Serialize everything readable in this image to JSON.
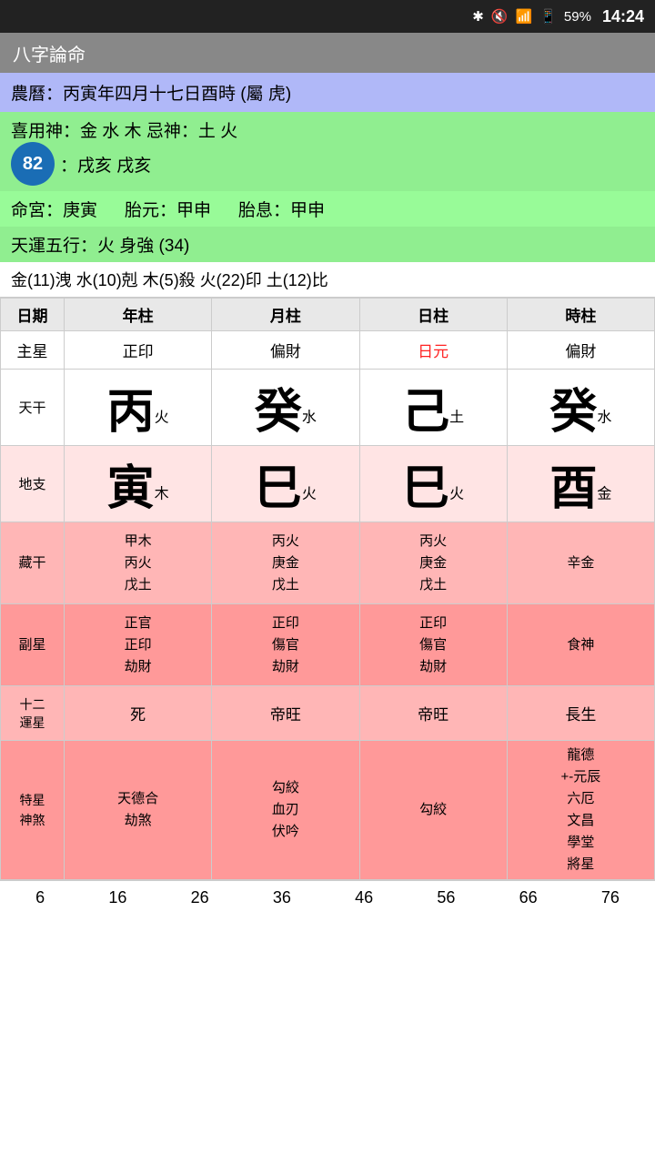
{
  "statusBar": {
    "battery": "59%",
    "time": "14:24"
  },
  "titleBar": {
    "title": "八字論命"
  },
  "lunar": {
    "text": "農曆：丙寅年四月十七日酉時 (屬 虎)"
  },
  "shenyong": {
    "line1": "喜用神：金 水 木          忌神：土 火",
    "badge": "82",
    "line2": "：戌亥 戌亥"
  },
  "mingong": {
    "mingong": "命宮：庚寅",
    "taiyuan": "胎元：甲申",
    "taixi": "胎息：甲申"
  },
  "tianyun": {
    "text": "天運五行：火               身強 (34)"
  },
  "wuxing": {
    "text": "金(11)洩  水(10)剋  木(5)殺  火(22)印  土(12)比"
  },
  "tableHeaders": {
    "label": "",
    "col1": "年柱",
    "col2": "月柱",
    "col3": "日柱",
    "col4": "時柱"
  },
  "rowDateLabel": "日期",
  "zhuxing": {
    "label": "主星",
    "col1": "正印",
    "col2": "偏財",
    "col3": "日元",
    "col4": "偏財",
    "col3Red": true
  },
  "tiangan": {
    "label": "天干",
    "col1Main": "丙",
    "col1Sub": "火",
    "col2Main": "癸",
    "col2Sub": "水",
    "col3Main": "己",
    "col3Sub": "土",
    "col4Main": "癸",
    "col4Sub": "水"
  },
  "dizhi": {
    "label": "地支",
    "col1Main": "寅",
    "col1Sub": "木",
    "col2Main": "巳",
    "col2Sub": "火",
    "col3Main": "巳",
    "col3Sub": "火",
    "col4Main": "酉",
    "col4Sub": "金"
  },
  "zanggan": {
    "label": "藏干",
    "col1": "甲木\n丙火\n戊土",
    "col2": "丙火\n庚金\n戊土",
    "col3": "丙火\n庚金\n戊土",
    "col4": "辛金"
  },
  "fuxing": {
    "label": "副星",
    "col1": "正官\n正印\n劫財",
    "col2": "正印\n傷官\n劫財",
    "col3": "正印\n傷官\n劫財",
    "col4": "食神"
  },
  "yunxing": {
    "label": "十二\n運星",
    "col1": "死",
    "col2": "帝旺",
    "col3": "帝旺",
    "col4": "長生"
  },
  "texing": {
    "label": "特星\n神煞",
    "col1": "天德合\n劫煞",
    "col2": "勾絞\n血刃\n伏吟",
    "col3": "勾絞",
    "col4": "龍德\n+-元辰\n六厄\n文昌\n學堂\n將星"
  },
  "bottomNumbers": [
    "6",
    "16",
    "26",
    "36",
    "46",
    "56",
    "66",
    "76"
  ]
}
